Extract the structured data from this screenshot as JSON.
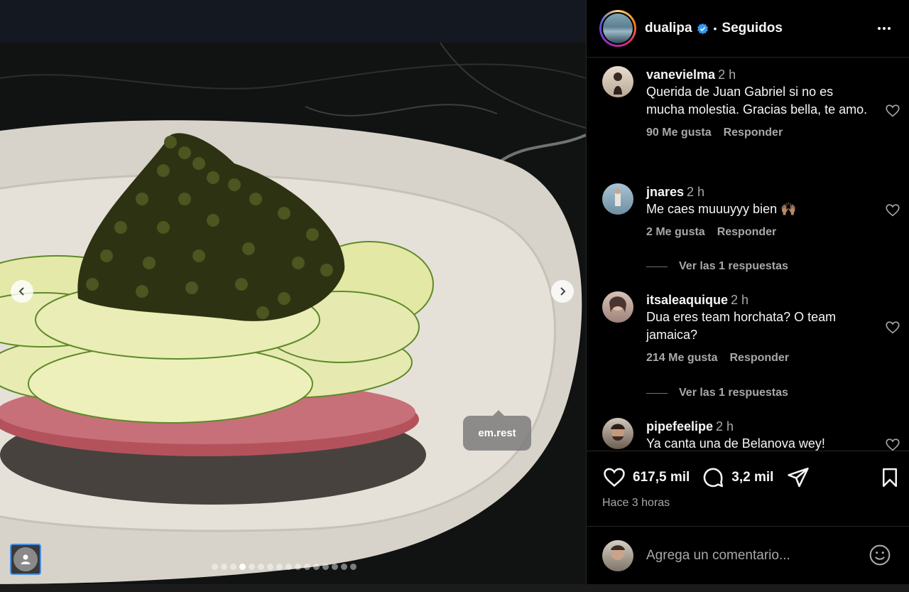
{
  "post": {
    "username": "dualipa",
    "follow_state": "Seguidos",
    "separator": "•",
    "media": {
      "tag_label": "em.rest",
      "carousel": {
        "total": 16,
        "active_index": 3
      }
    },
    "likes": "617,5 mil",
    "comments_count": "3,2 mil",
    "time_ago": "Hace 3 horas"
  },
  "comments": [
    {
      "user": "vanevielma",
      "time": "2 h",
      "text": "Querida de Juan Gabriel si no es mucha molestia. Gracias bella, te amo.",
      "likes": "90 Me gusta",
      "reply": "Responder",
      "replies": ""
    },
    {
      "user": "jnares",
      "time": "2 h",
      "text": "Me caes muuuyyy bien 🙌🏽",
      "likes": "2 Me gusta",
      "reply": "Responder",
      "replies": "Ver las 1 respuestas"
    },
    {
      "user": "itsaleaquique",
      "time": "2 h",
      "text": "Dua eres team horchata? O team jamaica?",
      "likes": "214 Me gusta",
      "reply": "Responder",
      "replies": "Ver las 1 respuestas"
    },
    {
      "user": "pipefeelipe",
      "time": "2 h",
      "text": "Ya canta una de Belanova wey!",
      "likes": "",
      "reply": "",
      "replies": ""
    }
  ],
  "add_comment": {
    "placeholder": "Agrega un comentario..."
  },
  "icons": {
    "verified": "verified-badge-icon",
    "more": "more-options-icon",
    "like": "heart-icon",
    "comment": "comment-bubble-icon",
    "share": "share-send-icon",
    "save": "bookmark-icon",
    "emoji": "emoji-icon",
    "prev": "chevron-left-icon",
    "next": "chevron-right-icon",
    "user_tag": "user-tag-icon"
  },
  "colors": {
    "verified_blue": "#3897f0",
    "background": "#000000",
    "text_secondary": "#a8a8a8"
  }
}
